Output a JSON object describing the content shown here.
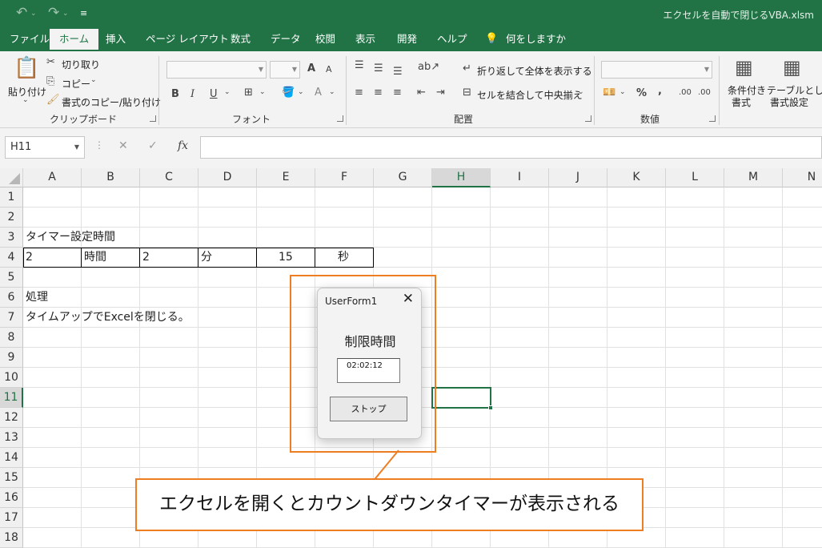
{
  "titlebar": {
    "title": "エクセルを自動で閉じるVBA.xlsm",
    "undo_icon": "undo-icon",
    "redo_icon": "redo-icon"
  },
  "tabs": [
    "ファイル",
    "ホーム",
    "挿入",
    "ページ レイアウト",
    "数式",
    "データ",
    "校閲",
    "表示",
    "開発",
    "ヘルプ"
  ],
  "tell_me": "何をしますか",
  "ribbon": {
    "clipboard": {
      "paste": "貼り付け",
      "cut": "切り取り",
      "copy": "コピー",
      "format_painter": "書式のコピー/貼り付け",
      "label": "クリップボード"
    },
    "font": {
      "label": "フォント",
      "bold": "B",
      "italic": "I",
      "underline": "U",
      "grow": "A",
      "shrink": "A",
      "font_color": "A"
    },
    "alignment": {
      "label": "配置",
      "wrap": "折り返して全体を表示する",
      "merge": "セルを結合して中央揃え"
    },
    "number": {
      "label": "数値",
      "percent": "%",
      "comma": ",",
      "inc_dec": ".00",
      "dec_dec": ".00"
    },
    "styles": {
      "cond_format_1": "条件付き",
      "cond_format_2": "書式",
      "table_1": "テーブルとして",
      "table_2": "書式設定"
    }
  },
  "formula_bar": {
    "namebox": "H11",
    "cancel": "✕",
    "enter": "✓",
    "fx": "fx",
    "value": ""
  },
  "columns": [
    "A",
    "B",
    "C",
    "D",
    "E",
    "F",
    "G",
    "H",
    "I",
    "J",
    "K",
    "L",
    "M",
    "N"
  ],
  "rows": [
    "1",
    "2",
    "3",
    "4",
    "5",
    "6",
    "7",
    "8",
    "9",
    "10",
    "11",
    "12",
    "13",
    "14",
    "15",
    "16",
    "17",
    "18"
  ],
  "cells": {
    "a3": "タイマー設定時間",
    "a4": "2",
    "b4": "時間",
    "c4": "2",
    "d4": "分",
    "e4": "15",
    "f4": "秒",
    "a6": "処理",
    "a7": "タイムアップでExcelを閉じる。"
  },
  "userform": {
    "title": "UserForm1",
    "close": "✕",
    "label": "制限時間",
    "time_value": "02:02:12",
    "stop_button": "ストップ"
  },
  "callout": {
    "text": "エクセルを開くとカウントダウンタイマーが表示される"
  },
  "colors": {
    "excel_green": "#217346",
    "highlight_orange": "#ef7d22"
  }
}
